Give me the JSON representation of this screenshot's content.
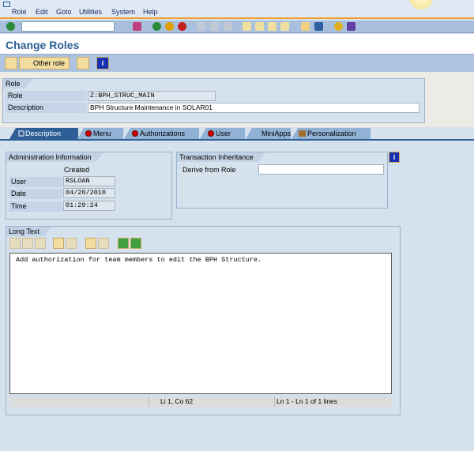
{
  "menu": [
    "Role",
    "Edit",
    "Goto",
    "Utilities",
    "System",
    "Help"
  ],
  "title": "Change Roles",
  "app_toolbar": {
    "other_role": "Other role"
  },
  "role_group": {
    "header": "Role",
    "role_label": "Role",
    "role_value": "Z:BPH_STRUC_MAIN",
    "desc_label": "Description",
    "desc_value": "BPH Structure Maintenance in SOLAR01"
  },
  "tabs": [
    "Description",
    "Menu",
    "Authorizations",
    "User",
    "MiniApps",
    "Personalization"
  ],
  "admin": {
    "header": "Administration Information",
    "created": "Created",
    "user_label": "User",
    "user": "RSLOAN",
    "date_label": "Date",
    "date": "04/20/2010",
    "time_label": "Time",
    "time": "01:29:24"
  },
  "inherit": {
    "header": "Transaction Inheritance",
    "derive_label": "Derive from Role",
    "derive_value": ""
  },
  "long_text": {
    "header": "Long Text",
    "text": "Add authorization for team members to edit the BPH Structure.",
    "cursor": "Li 1, Co 62",
    "lines": "Ln 1 - Ln 1 of 1 lines"
  }
}
